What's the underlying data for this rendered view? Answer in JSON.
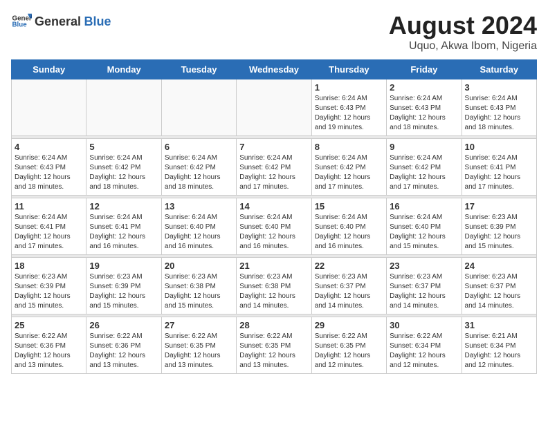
{
  "header": {
    "logo_general": "General",
    "logo_blue": "Blue",
    "month_year": "August 2024",
    "location": "Uquo, Akwa Ibom, Nigeria"
  },
  "weekdays": [
    "Sunday",
    "Monday",
    "Tuesday",
    "Wednesday",
    "Thursday",
    "Friday",
    "Saturday"
  ],
  "weeks": [
    [
      {
        "day": "",
        "info": ""
      },
      {
        "day": "",
        "info": ""
      },
      {
        "day": "",
        "info": ""
      },
      {
        "day": "",
        "info": ""
      },
      {
        "day": "1",
        "info": "Sunrise: 6:24 AM\nSunset: 6:43 PM\nDaylight: 12 hours\nand 19 minutes."
      },
      {
        "day": "2",
        "info": "Sunrise: 6:24 AM\nSunset: 6:43 PM\nDaylight: 12 hours\nand 18 minutes."
      },
      {
        "day": "3",
        "info": "Sunrise: 6:24 AM\nSunset: 6:43 PM\nDaylight: 12 hours\nand 18 minutes."
      }
    ],
    [
      {
        "day": "4",
        "info": "Sunrise: 6:24 AM\nSunset: 6:43 PM\nDaylight: 12 hours\nand 18 minutes."
      },
      {
        "day": "5",
        "info": "Sunrise: 6:24 AM\nSunset: 6:42 PM\nDaylight: 12 hours\nand 18 minutes."
      },
      {
        "day": "6",
        "info": "Sunrise: 6:24 AM\nSunset: 6:42 PM\nDaylight: 12 hours\nand 18 minutes."
      },
      {
        "day": "7",
        "info": "Sunrise: 6:24 AM\nSunset: 6:42 PM\nDaylight: 12 hours\nand 17 minutes."
      },
      {
        "day": "8",
        "info": "Sunrise: 6:24 AM\nSunset: 6:42 PM\nDaylight: 12 hours\nand 17 minutes."
      },
      {
        "day": "9",
        "info": "Sunrise: 6:24 AM\nSunset: 6:42 PM\nDaylight: 12 hours\nand 17 minutes."
      },
      {
        "day": "10",
        "info": "Sunrise: 6:24 AM\nSunset: 6:41 PM\nDaylight: 12 hours\nand 17 minutes."
      }
    ],
    [
      {
        "day": "11",
        "info": "Sunrise: 6:24 AM\nSunset: 6:41 PM\nDaylight: 12 hours\nand 17 minutes."
      },
      {
        "day": "12",
        "info": "Sunrise: 6:24 AM\nSunset: 6:41 PM\nDaylight: 12 hours\nand 16 minutes."
      },
      {
        "day": "13",
        "info": "Sunrise: 6:24 AM\nSunset: 6:40 PM\nDaylight: 12 hours\nand 16 minutes."
      },
      {
        "day": "14",
        "info": "Sunrise: 6:24 AM\nSunset: 6:40 PM\nDaylight: 12 hours\nand 16 minutes."
      },
      {
        "day": "15",
        "info": "Sunrise: 6:24 AM\nSunset: 6:40 PM\nDaylight: 12 hours\nand 16 minutes."
      },
      {
        "day": "16",
        "info": "Sunrise: 6:24 AM\nSunset: 6:40 PM\nDaylight: 12 hours\nand 15 minutes."
      },
      {
        "day": "17",
        "info": "Sunrise: 6:23 AM\nSunset: 6:39 PM\nDaylight: 12 hours\nand 15 minutes."
      }
    ],
    [
      {
        "day": "18",
        "info": "Sunrise: 6:23 AM\nSunset: 6:39 PM\nDaylight: 12 hours\nand 15 minutes."
      },
      {
        "day": "19",
        "info": "Sunrise: 6:23 AM\nSunset: 6:39 PM\nDaylight: 12 hours\nand 15 minutes."
      },
      {
        "day": "20",
        "info": "Sunrise: 6:23 AM\nSunset: 6:38 PM\nDaylight: 12 hours\nand 15 minutes."
      },
      {
        "day": "21",
        "info": "Sunrise: 6:23 AM\nSunset: 6:38 PM\nDaylight: 12 hours\nand 14 minutes."
      },
      {
        "day": "22",
        "info": "Sunrise: 6:23 AM\nSunset: 6:37 PM\nDaylight: 12 hours\nand 14 minutes."
      },
      {
        "day": "23",
        "info": "Sunrise: 6:23 AM\nSunset: 6:37 PM\nDaylight: 12 hours\nand 14 minutes."
      },
      {
        "day": "24",
        "info": "Sunrise: 6:23 AM\nSunset: 6:37 PM\nDaylight: 12 hours\nand 14 minutes."
      }
    ],
    [
      {
        "day": "25",
        "info": "Sunrise: 6:22 AM\nSunset: 6:36 PM\nDaylight: 12 hours\nand 13 minutes."
      },
      {
        "day": "26",
        "info": "Sunrise: 6:22 AM\nSunset: 6:36 PM\nDaylight: 12 hours\nand 13 minutes."
      },
      {
        "day": "27",
        "info": "Sunrise: 6:22 AM\nSunset: 6:35 PM\nDaylight: 12 hours\nand 13 minutes."
      },
      {
        "day": "28",
        "info": "Sunrise: 6:22 AM\nSunset: 6:35 PM\nDaylight: 12 hours\nand 13 minutes."
      },
      {
        "day": "29",
        "info": "Sunrise: 6:22 AM\nSunset: 6:35 PM\nDaylight: 12 hours\nand 12 minutes."
      },
      {
        "day": "30",
        "info": "Sunrise: 6:22 AM\nSunset: 6:34 PM\nDaylight: 12 hours\nand 12 minutes."
      },
      {
        "day": "31",
        "info": "Sunrise: 6:21 AM\nSunset: 6:34 PM\nDaylight: 12 hours\nand 12 minutes."
      }
    ]
  ]
}
